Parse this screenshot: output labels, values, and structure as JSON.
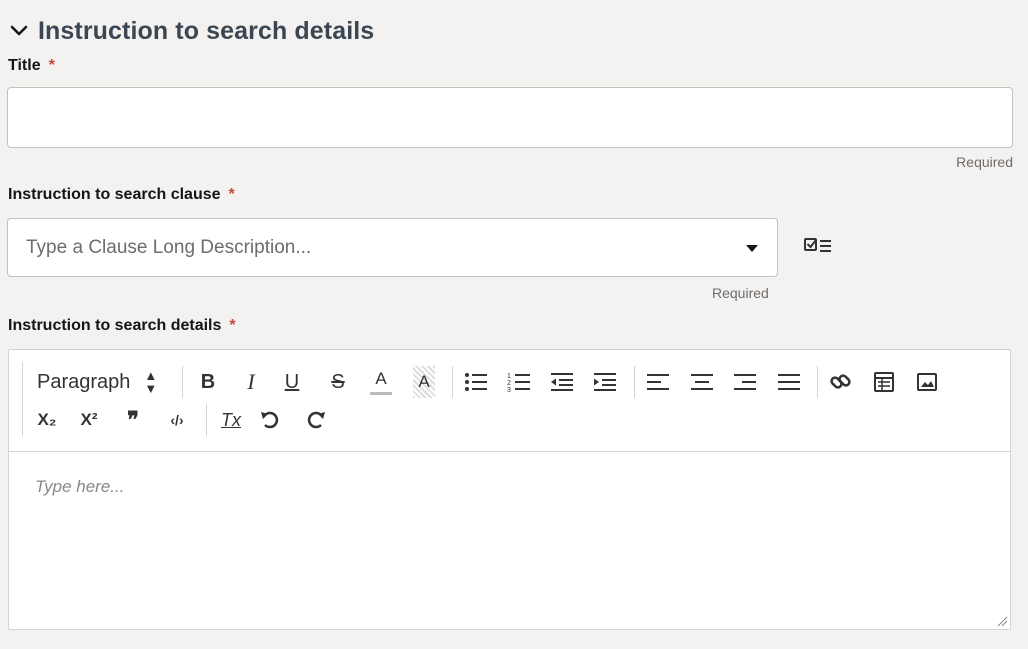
{
  "section": {
    "title": "Instruction to search details"
  },
  "title_field": {
    "label": "Title",
    "required_mark": "*",
    "value": "",
    "helper": "Required"
  },
  "clause_field": {
    "label": "Instruction to search clause",
    "required_mark": "*",
    "placeholder": "Type a Clause Long Description...",
    "helper": "Required"
  },
  "details_field": {
    "label": "Instruction to search details",
    "required_mark": "*",
    "editor_placeholder": "Type here..."
  },
  "toolbar": {
    "format_select": "Paragraph",
    "icons": [
      "bold",
      "italic",
      "underline",
      "strikethrough",
      "font-color",
      "background-color",
      "bulleted-list",
      "numbered-list",
      "outdent",
      "indent",
      "align-left",
      "align-center",
      "align-right",
      "justify",
      "link",
      "table",
      "image",
      "subscript",
      "superscript",
      "blockquote",
      "code",
      "clear-format",
      "undo",
      "redo"
    ],
    "bold_label": "B",
    "italic_label": "I",
    "underline_label": "U",
    "strike_label": "S",
    "fontcolor_label": "A",
    "bgcolor_label": "A",
    "subscript_label": "X₂",
    "superscript_label": "X²",
    "quote_label": "❞",
    "code_label": "‹/›",
    "clear_label": "Tx"
  },
  "colors": {
    "required": "#c74634",
    "header": "#3a4753",
    "background": "#f3f2f1"
  }
}
